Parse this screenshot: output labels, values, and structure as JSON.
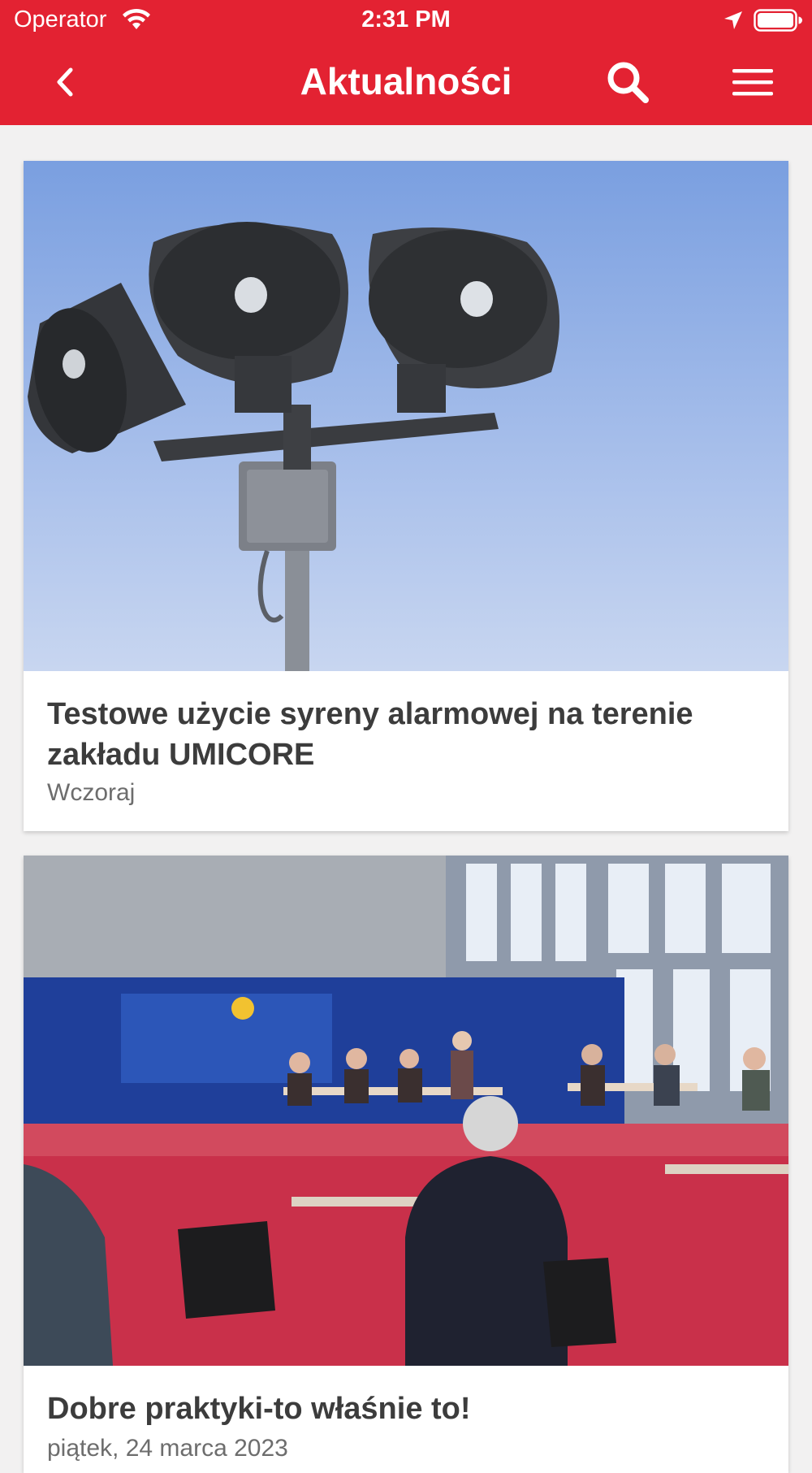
{
  "status_bar": {
    "carrier": "Operator",
    "time": "2:31 PM"
  },
  "header": {
    "title": "Aktualności",
    "background_color": "#e32232"
  },
  "news": [
    {
      "title": "Testowe użycie syreny alarmowej na terenie zakładu UMICORE",
      "date": "Wczoraj",
      "image": "alarm-sirens-photo"
    },
    {
      "title": "Dobre praktyki-to właśnie to!",
      "date": "piątek, 24 marca 2023",
      "image": "meeting-gym-photo"
    }
  ]
}
